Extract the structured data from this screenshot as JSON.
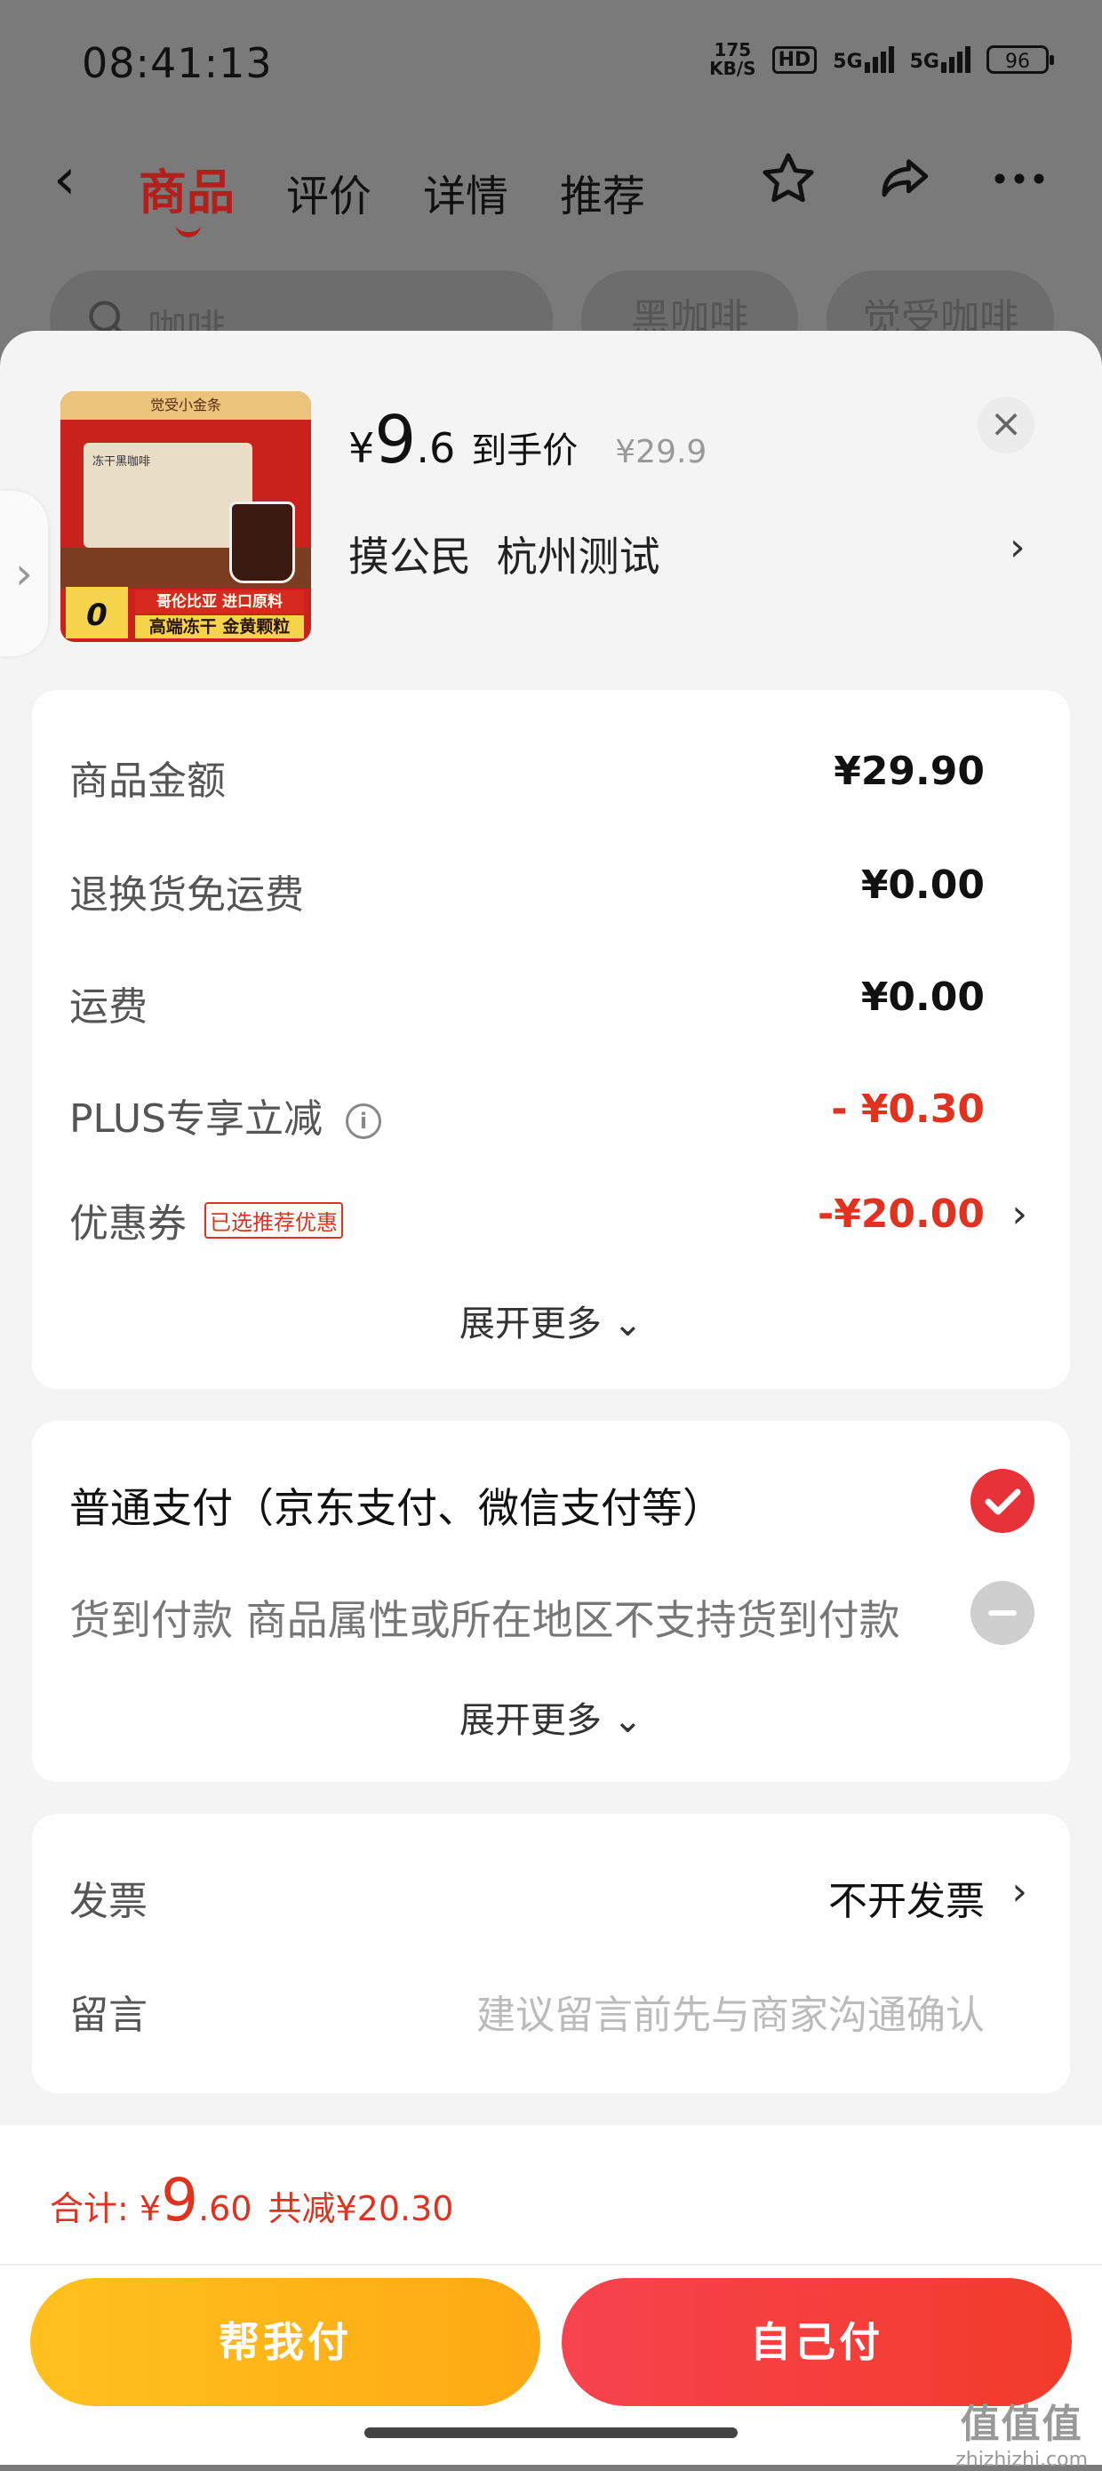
{
  "status_bar": {
    "time": "08:41:13",
    "net_speed_value": "175",
    "net_speed_unit": "KB/S",
    "hd": "HD",
    "sim1": "5G",
    "sim2": "5G",
    "battery": "96"
  },
  "nav": {
    "tabs": [
      {
        "label": "商品",
        "active": true
      },
      {
        "label": "评价",
        "active": false
      },
      {
        "label": "详情",
        "active": false
      },
      {
        "label": "推荐",
        "active": false
      }
    ]
  },
  "search": {
    "placeholder": "咖啡",
    "chips": [
      "黑咖啡",
      "觉受咖啡"
    ]
  },
  "product": {
    "image_top": "觉受小金条",
    "image_box": "冻干黑咖啡",
    "image_ribbon1": "哥伦比亚 进口原料",
    "image_ribbon2": "高端冻干 金黄颗粒",
    "image_zero": "0",
    "price_symbol": "¥",
    "price_int": "9",
    "price_dec": ".6",
    "price_tag": "到手价",
    "original_price": "¥29.9",
    "address": "摸公民  杭州测试"
  },
  "cost": {
    "rows": [
      {
        "label": "商品金额",
        "value": "¥29.90"
      },
      {
        "label": "退换货免运费",
        "value": "¥0.00"
      },
      {
        "label": "运费",
        "value": "¥0.00"
      },
      {
        "label": "PLUS专享立减",
        "value": "- ¥0.30"
      },
      {
        "label": "优惠券",
        "badge": "已选推荐优惠",
        "value": "-¥20.00"
      }
    ],
    "expand": "展开更多"
  },
  "payment": {
    "options": [
      {
        "label": "普通支付（京东支付、微信支付等）",
        "selected": true
      },
      {
        "label": "货到付款 商品属性或所在地区不支持货到付款",
        "selected": false
      }
    ],
    "expand": "展开更多"
  },
  "extra": {
    "invoice_label": "发票",
    "invoice_value": "不开发票",
    "message_label": "留言",
    "message_placeholder": "建议留言前先与商家沟通确认"
  },
  "footer": {
    "total_label": "合计: ¥",
    "total_int": "9",
    "total_dec": ".60",
    "discount": "共减¥20.30",
    "help_pay": "帮我付",
    "self_pay": "自己付"
  },
  "watermark": {
    "line1": "值值值",
    "line2": "zhizhizhi.com"
  },
  "colors": {
    "accent_red": "#e0321f",
    "pay_yellow": "#ffb818",
    "pay_red": "#f23b3a"
  }
}
